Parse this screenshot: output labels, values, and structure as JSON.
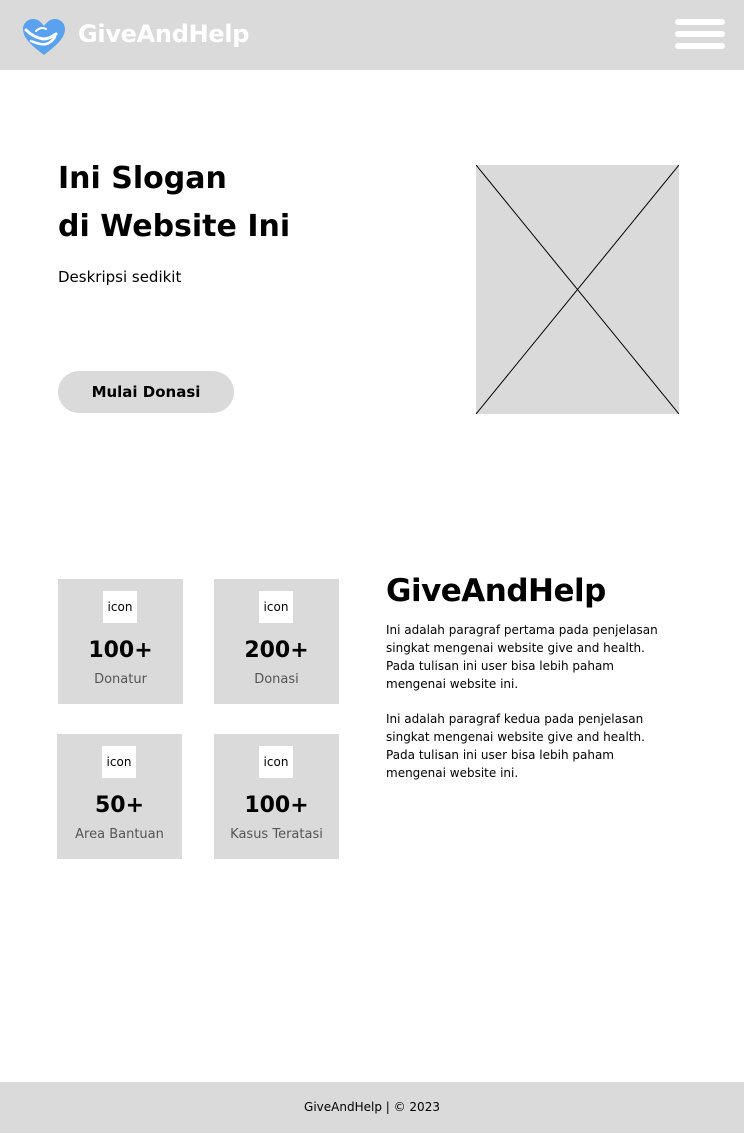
{
  "header": {
    "brand": "GiveAndHelp",
    "logo_icon": "heart-hand-icon",
    "menu_icon": "hamburger-menu-icon",
    "logo_color": "#5aa2f0"
  },
  "hero": {
    "title_line1": "Ini Slogan",
    "title_line2": "di Website Ini",
    "description": "Deskripsi sedikit",
    "cta_label": "Mulai Donasi",
    "image_icon": "image-placeholder-icon"
  },
  "stats": [
    {
      "icon_label": "icon",
      "value": "100+",
      "label": "Donatur"
    },
    {
      "icon_label": "icon",
      "value": "200+",
      "label": "Donasi"
    },
    {
      "icon_label": "icon",
      "value": "50+",
      "label": "Area Bantuan"
    },
    {
      "icon_label": "icon",
      "value": "100+",
      "label": "Kasus Teratasi"
    }
  ],
  "about": {
    "title": "GiveAndHelp",
    "paragraph1": "Ini adalah paragraf pertama pada penjelasan singkat mengenai website give and health. Pada tulisan ini user bisa lebih paham mengenai website ini.",
    "paragraph2": "Ini adalah paragraf kedua pada penjelasan singkat mengenai website give and health. Pada tulisan ini user bisa lebih paham mengenai website ini."
  },
  "footer": {
    "text": "GiveAndHelp | © 2023"
  },
  "colors": {
    "panel_gray": "#dadada",
    "white": "#ffffff"
  }
}
